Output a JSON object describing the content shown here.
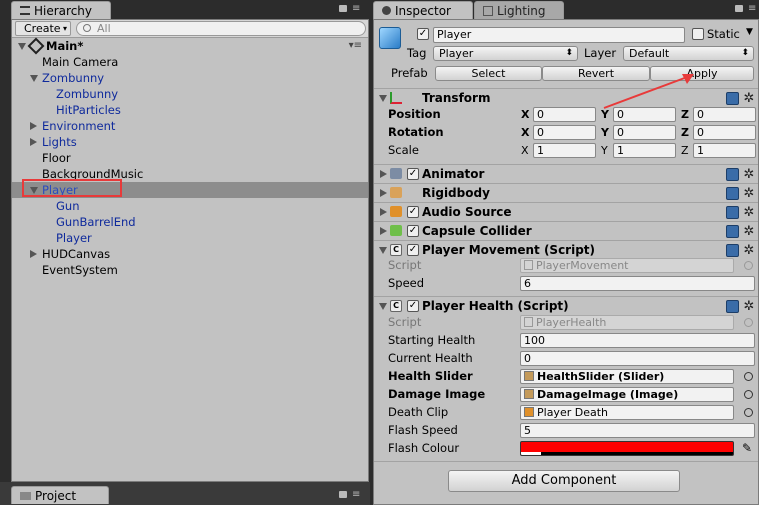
{
  "hierarchy": {
    "tab_label": "Hierarchy",
    "create_label": "Create",
    "search_placeholder": "All",
    "scene_name": "Main*",
    "items": [
      {
        "label": "Main Camera",
        "blue": false,
        "indent": 1,
        "arrow": ""
      },
      {
        "label": "Zombunny",
        "blue": true,
        "indent": 1,
        "arrow": "down"
      },
      {
        "label": "Zombunny",
        "blue": true,
        "indent": 2,
        "arrow": ""
      },
      {
        "label": "HitParticles",
        "blue": true,
        "indent": 2,
        "arrow": ""
      },
      {
        "label": "Environment",
        "blue": true,
        "indent": 1,
        "arrow": "right"
      },
      {
        "label": "Lights",
        "blue": true,
        "indent": 1,
        "arrow": "right"
      },
      {
        "label": "Floor",
        "blue": false,
        "indent": 1,
        "arrow": ""
      },
      {
        "label": "BackgroundMusic",
        "blue": false,
        "indent": 1,
        "arrow": ""
      },
      {
        "label": "Player",
        "blue": true,
        "indent": 1,
        "arrow": "down",
        "selected": true
      },
      {
        "label": "Gun",
        "blue": true,
        "indent": 2,
        "arrow": ""
      },
      {
        "label": "GunBarrelEnd",
        "blue": true,
        "indent": 2,
        "arrow": ""
      },
      {
        "label": "Player",
        "blue": true,
        "indent": 2,
        "arrow": ""
      },
      {
        "label": "HUDCanvas",
        "blue": false,
        "indent": 1,
        "arrow": "right"
      },
      {
        "label": "EventSystem",
        "blue": false,
        "indent": 1,
        "arrow": ""
      }
    ]
  },
  "project": {
    "tab_label": "Project"
  },
  "inspector": {
    "tab_label": "Inspector",
    "lighting_tab_label": "Lighting",
    "object_name": "Player",
    "static_label": "Static",
    "tag_label": "Tag",
    "tag_value": "Player",
    "layer_label": "Layer",
    "layer_value": "Default",
    "prefab_label": "Prefab",
    "select_label": "Select",
    "revert_label": "Revert",
    "apply_label": "Apply",
    "transform": {
      "title": "Transform",
      "rows": [
        {
          "label": "Position",
          "x": "0",
          "y": "0",
          "z": "0",
          "bold": true
        },
        {
          "label": "Rotation",
          "x": "0",
          "y": "0",
          "z": "0",
          "bold": true
        },
        {
          "label": "Scale",
          "x": "1",
          "y": "1",
          "z": "1",
          "bold": false
        }
      ]
    },
    "components": [
      "Animator",
      "Rigidbody",
      "Audio Source",
      "Capsule Collider"
    ],
    "player_movement": {
      "title": "Player Movement (Script)",
      "script_label": "Script",
      "script_value": "PlayerMovement",
      "speed_label": "Speed",
      "speed_value": "6"
    },
    "player_health": {
      "title": "Player Health (Script)",
      "script_label": "Script",
      "script_value": "PlayerHealth",
      "fields": [
        {
          "label": "Starting Health",
          "value": "100",
          "bold": false
        },
        {
          "label": "Current Health",
          "value": "0",
          "bold": false
        },
        {
          "label": "Health Slider",
          "value": "HealthSlider (Slider)",
          "bold": true
        },
        {
          "label": "Damage Image",
          "value": "DamageImage (Image)",
          "bold": true
        },
        {
          "label": "Death Clip",
          "value": "Player Death",
          "bold": false
        },
        {
          "label": "Flash Speed",
          "value": "5",
          "bold": false
        },
        {
          "label": "Flash Colour",
          "value": "",
          "bold": false
        }
      ],
      "flash_colour": "#ff0000"
    },
    "add_component_label": "Add Component"
  },
  "colors": {
    "selection_highlight": "#8d8d8d",
    "annotation": "#e83a3a"
  }
}
